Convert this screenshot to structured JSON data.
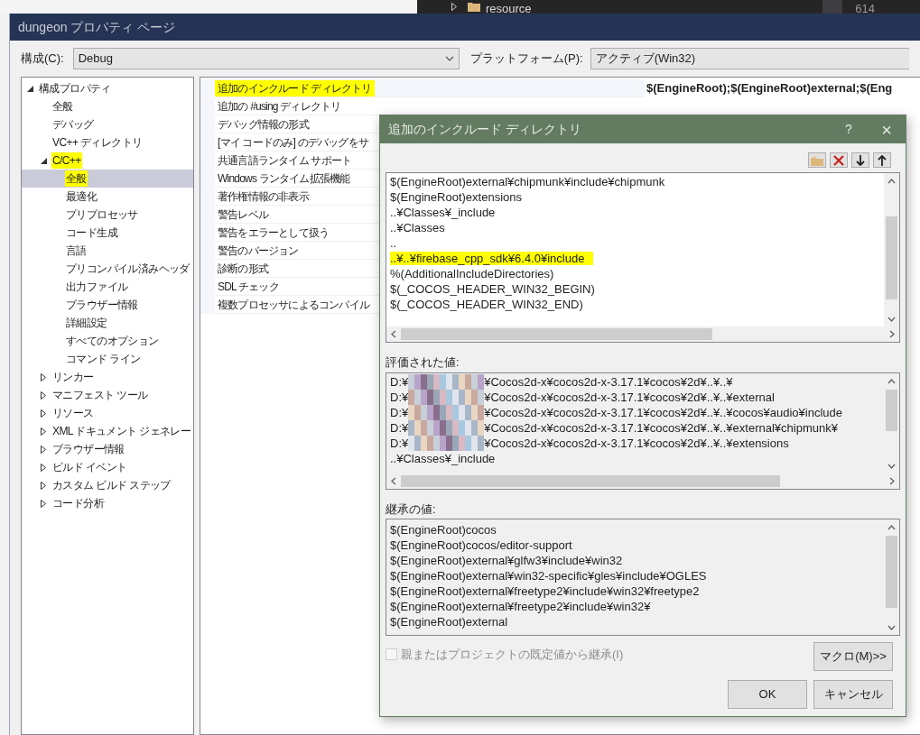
{
  "background": {
    "tree_item": "resource",
    "line_number": "614"
  },
  "window": {
    "title": "dungeon プロパティ ページ"
  },
  "config": {
    "label": "構成(C):",
    "value": "Debug"
  },
  "platform": {
    "label": "プラットフォーム(P):",
    "value": "アクティブ(Win32)"
  },
  "tree": [
    {
      "label": "構成プロパティ",
      "expanded": true,
      "selected": false,
      "highlighted": false,
      "children": [
        {
          "label": "全般",
          "selected": false,
          "highlighted": false
        },
        {
          "label": "デバッグ",
          "selected": false,
          "highlighted": false
        },
        {
          "label": "VC++ ディレクトリ",
          "selected": false,
          "highlighted": false
        },
        {
          "label": "C/C++",
          "expanded": true,
          "selected": false,
          "highlighted": true,
          "children": [
            {
              "label": "全般",
              "selected": true,
              "highlighted": true
            },
            {
              "label": "最適化",
              "selected": false,
              "highlighted": false
            },
            {
              "label": "プリプロセッサ",
              "selected": false,
              "highlighted": false
            },
            {
              "label": "コード生成",
              "selected": false,
              "highlighted": false
            },
            {
              "label": "言語",
              "selected": false,
              "highlighted": false
            },
            {
              "label": "プリコンパイル済みヘッダ",
              "selected": false,
              "highlighted": false
            },
            {
              "label": "出力ファイル",
              "selected": false,
              "highlighted": false
            },
            {
              "label": "ブラウザー情報",
              "selected": false,
              "highlighted": false
            },
            {
              "label": "詳細設定",
              "selected": false,
              "highlighted": false
            },
            {
              "label": "すべてのオプション",
              "selected": false,
              "highlighted": false
            },
            {
              "label": "コマンド ライン",
              "selected": false,
              "highlighted": false
            }
          ]
        },
        {
          "label": "リンカー",
          "expanded": false,
          "selected": false,
          "highlighted": false
        },
        {
          "label": "マニフェスト ツール",
          "expanded": false,
          "selected": false,
          "highlighted": false
        },
        {
          "label": "リソース",
          "expanded": false,
          "selected": false,
          "highlighted": false
        },
        {
          "label": "XML ドキュメント ジェネレー",
          "expanded": false,
          "selected": false,
          "highlighted": false
        },
        {
          "label": "ブラウザー情報",
          "expanded": false,
          "selected": false,
          "highlighted": false
        },
        {
          "label": "ビルド イベント",
          "expanded": false,
          "selected": false,
          "highlighted": false
        },
        {
          "label": "カスタム ビルド ステップ",
          "expanded": false,
          "selected": false,
          "highlighted": false
        },
        {
          "label": "コード分析",
          "expanded": false,
          "selected": false,
          "highlighted": false
        }
      ]
    }
  ],
  "properties": [
    {
      "name": "追加のインクルード ディレクトリ",
      "value": "$(EngineRoot);$(EngineRoot)external;$(Eng",
      "highlighted": true
    },
    {
      "name": "追加の #using ディレクトリ",
      "highlighted": false
    },
    {
      "name": "デバッグ情報の形式",
      "highlighted": false
    },
    {
      "name": "[マイ コードのみ] のデバッグをサ",
      "highlighted": false
    },
    {
      "name": "共通言語ランタイム サポート",
      "highlighted": false
    },
    {
      "name": "Windows ランタイム拡張機能",
      "highlighted": false
    },
    {
      "name": "著作権情報の非表示",
      "highlighted": false
    },
    {
      "name": "警告レベル",
      "highlighted": false
    },
    {
      "name": "警告をエラーとして扱う",
      "highlighted": false
    },
    {
      "name": "警告のバージョン",
      "highlighted": false
    },
    {
      "name": "診断の形式",
      "highlighted": false
    },
    {
      "name": "SDL チェック",
      "highlighted": false
    },
    {
      "name": "複数プロセッサによるコンパイル",
      "highlighted": false
    }
  ],
  "dialog": {
    "title": "追加のインクルード ディレクトリ",
    "help": "?",
    "close": "×",
    "entries": [
      {
        "text": "$(EngineRoot)external¥chipmunk¥include¥chipmunk",
        "highlighted": false
      },
      {
        "text": "$(EngineRoot)extensions",
        "highlighted": false
      },
      {
        "text": "..¥Classes¥_include",
        "highlighted": false
      },
      {
        "text": "..¥Classes",
        "highlighted": false
      },
      {
        "text": "..",
        "highlighted": false
      },
      {
        "text": "..¥..¥firebase_cpp_sdk¥6.4.0¥include",
        "highlighted": true
      },
      {
        "text": "%(AdditionalIncludeDirectories)",
        "highlighted": false
      },
      {
        "text": "$(_COCOS_HEADER_WIN32_BEGIN)",
        "highlighted": false
      },
      {
        "text": "$(_COCOS_HEADER_WIN32_END)",
        "highlighted": false
      }
    ],
    "evaluated_label": "評価された値:",
    "evaluated": [
      {
        "prefix": "D:¥",
        "redacted": true,
        "rest": "¥Cocos2d-x¥cocos2d-x-3.17.1¥cocos¥2d¥..¥..¥"
      },
      {
        "prefix": "D:¥",
        "redacted": true,
        "rest": "¥Cocos2d-x¥cocos2d-x-3.17.1¥cocos¥2d¥..¥..¥external"
      },
      {
        "prefix": "D:¥",
        "redacted": true,
        "rest": "¥Cocos2d-x¥cocos2d-x-3.17.1¥cocos¥2d¥..¥..¥cocos¥audio¥include"
      },
      {
        "prefix": "D:¥",
        "redacted": true,
        "rest": "¥Cocos2d-x¥cocos2d-x-3.17.1¥cocos¥2d¥..¥..¥external¥chipmunk¥"
      },
      {
        "prefix": "D:¥",
        "redacted": true,
        "rest": "¥Cocos2d-x¥cocos2d-x-3.17.1¥cocos¥2d¥..¥..¥extensions"
      },
      {
        "prefix": "..¥Classes¥_include",
        "redacted": false
      }
    ],
    "inherited_label": "継承の値:",
    "inherited": [
      "$(EngineRoot)cocos",
      "$(EngineRoot)cocos/editor-support",
      "$(EngineRoot)external¥glfw3¥include¥win32",
      "$(EngineRoot)external¥win32-specific¥gles¥include¥OGLES",
      "$(EngineRoot)external¥freetype2¥include¥win32¥freetype2",
      "$(EngineRoot)external¥freetype2¥include¥win32¥",
      "$(EngineRoot)external"
    ],
    "inherit_checkbox": {
      "label": "親またはプロジェクトの既定値から継承(I)",
      "checked": false,
      "disabled": true
    },
    "macro_button": "マクロ(M)>>",
    "ok": "OK",
    "cancel": "キャンセル"
  }
}
